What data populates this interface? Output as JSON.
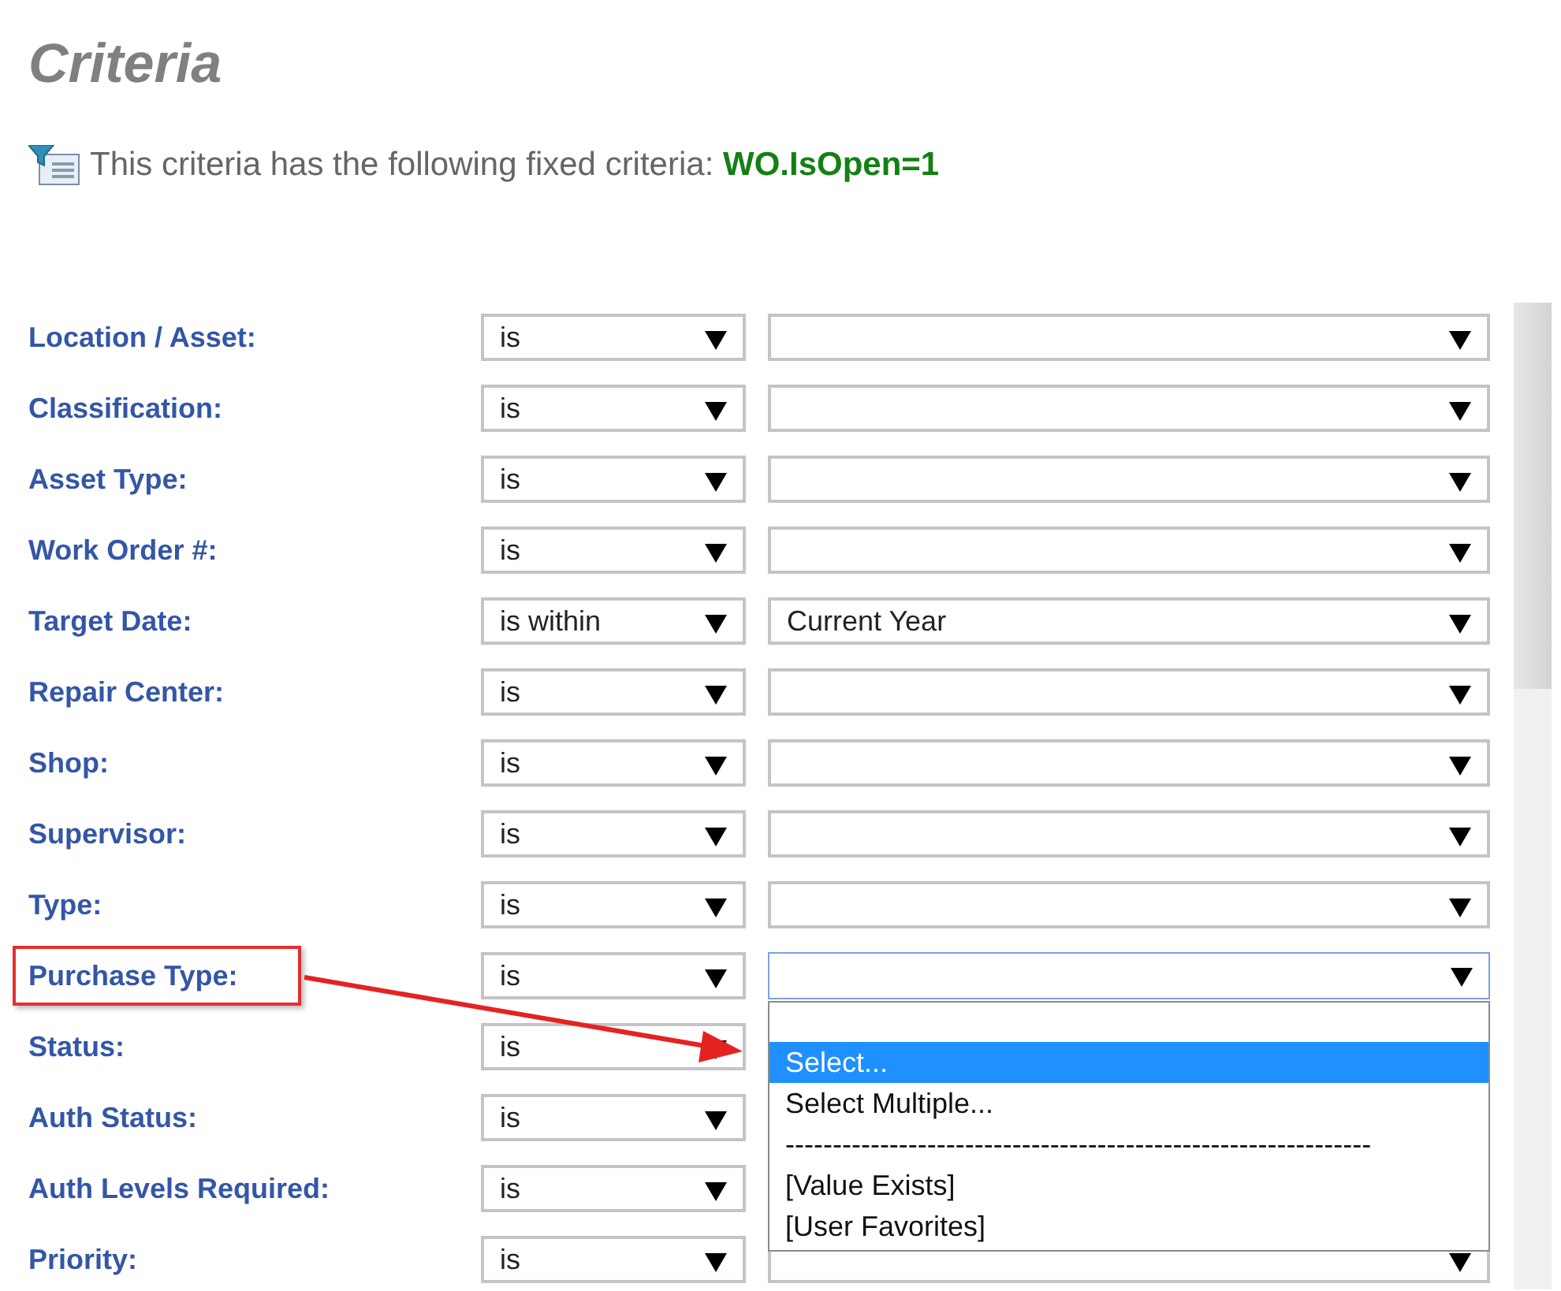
{
  "title": "Criteria",
  "fixed_criteria": {
    "text": "This criteria has the following fixed criteria:",
    "value": "WO.IsOpen=1"
  },
  "criteria": [
    {
      "label": "Location / Asset:",
      "operator": "is"
    },
    {
      "label": "Classification:",
      "operator": "is"
    },
    {
      "label": "Asset Type:",
      "operator": "is"
    },
    {
      "label": "Work Order #:",
      "operator": "is"
    },
    {
      "label": "Target Date:",
      "operator": "is within",
      "value": "Current Year"
    },
    {
      "label": "Repair Center:",
      "operator": "is"
    },
    {
      "label": "Shop:",
      "operator": "is"
    },
    {
      "label": "Supervisor:",
      "operator": "is"
    },
    {
      "label": "Type:",
      "operator": "is"
    },
    {
      "label": "Purchase Type:",
      "operator": "is",
      "open": true,
      "highlighted": true,
      "options": [
        {
          "label": "Select...",
          "selected": true
        },
        {
          "label": "Select Multiple...",
          "selected": false
        },
        {
          "label": "--------------------------------------------------------------",
          "selected": false
        },
        {
          "label": "[Value Exists]",
          "selected": false
        },
        {
          "label": "[User Favorites]",
          "selected": false
        }
      ]
    },
    {
      "label": "Status:",
      "operator": "is"
    },
    {
      "label": "Auth Status:",
      "operator": "is"
    },
    {
      "label": "Auth Levels Required:",
      "operator": "is"
    },
    {
      "label": "Priority:",
      "operator": "is"
    }
  ]
}
